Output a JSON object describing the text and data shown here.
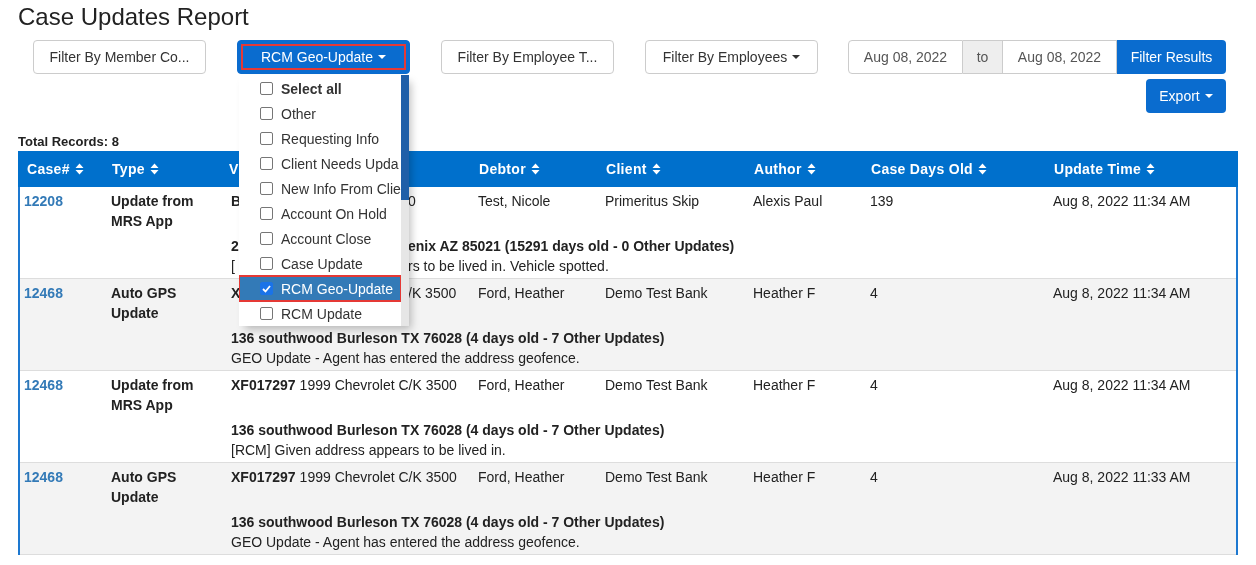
{
  "title": "Case Updates Report",
  "filters": [
    {
      "label": "Filter By Member Co...",
      "caret": false,
      "active": false,
      "annotated": false
    },
    {
      "label": "RCM Geo-Update",
      "caret": true,
      "active": true,
      "annotated": true
    },
    {
      "label": "Filter By Employee T...",
      "caret": false,
      "active": false,
      "annotated": false
    },
    {
      "label": "Filter By Employees",
      "caret": true,
      "active": false,
      "annotated": false
    }
  ],
  "dropdown": {
    "items": [
      {
        "label": "Select all",
        "kind": "all",
        "checked": false,
        "annotated": false
      },
      {
        "label": "Other",
        "kind": "option",
        "checked": false,
        "annotated": false
      },
      {
        "label": "Requesting Info",
        "kind": "option",
        "checked": false,
        "annotated": false
      },
      {
        "label": "Client Needs Upda",
        "kind": "option",
        "checked": false,
        "annotated": false
      },
      {
        "label": "New Info From Clie",
        "kind": "option",
        "checked": false,
        "annotated": false
      },
      {
        "label": "Account On Hold",
        "kind": "option",
        "checked": false,
        "annotated": false
      },
      {
        "label": "Account Close",
        "kind": "option",
        "checked": false,
        "annotated": false
      },
      {
        "label": "Case Update",
        "kind": "option",
        "checked": false,
        "annotated": false
      },
      {
        "label": "RCM Geo-Update",
        "kind": "option",
        "checked": true,
        "annotated": true
      },
      {
        "label": "RCM Update",
        "kind": "option",
        "checked": false,
        "annotated": false
      }
    ]
  },
  "date_range": {
    "from": "Aug 08, 2022",
    "separator": "to",
    "to": "Aug 08, 2022",
    "submit": "Filter Results"
  },
  "export": {
    "label": "Export"
  },
  "total_records": "Total Records: 8",
  "table": {
    "columns": [
      {
        "label": "Case#",
        "sortable": true
      },
      {
        "label": "Type",
        "sortable": true
      },
      {
        "label": "V",
        "sortable": false
      },
      {
        "label": "Debtor",
        "sortable": true
      },
      {
        "label": "Client",
        "sortable": true
      },
      {
        "label": "Author",
        "sortable": true
      },
      {
        "label": "Case Days Old",
        "sortable": true
      },
      {
        "label": "Update Time",
        "sortable": true
      }
    ],
    "rows": [
      {
        "case": "12208",
        "type": "Update from MRS App",
        "vehicle": [
          {
            "text": "B",
            "bold": true,
            "after_overlay": false
          },
          {
            "text": "0",
            "bold": false,
            "after_overlay": true
          }
        ],
        "debtor": "Test, Nicole",
        "client": "Primeritus Skip",
        "author": "Alexis Paul",
        "days": "139",
        "time": "Aug 8, 2022 11:34 AM",
        "address": [
          {
            "text": "2",
            "after_overlay": false
          },
          {
            "text": "enix AZ 85021 (15291 days old - 0 Other Updates)",
            "after_overlay": true
          }
        ],
        "note": [
          {
            "text": "[",
            "after_overlay": false
          },
          {
            "text": "rs to be lived in. Vehicle spotted.",
            "after_overlay": true
          }
        ]
      },
      {
        "case": "12468",
        "type": "Auto GPS Update",
        "vehicle": [
          {
            "text": "X",
            "bold": true,
            "after_overlay": false
          },
          {
            "text": "/K 3500",
            "bold": false,
            "after_overlay": true
          }
        ],
        "debtor": "Ford, Heather",
        "client": "Demo Test Bank",
        "author": "Heather F",
        "days": "4",
        "time": "Aug 8, 2022 11:34 AM",
        "address": [
          {
            "text": "136 southwood Burleson TX 76028 (4 days old - 7 Other Updates)"
          }
        ],
        "note": [
          {
            "text": "GEO Update - Agent has entered the address geofence."
          }
        ]
      },
      {
        "case": "12468",
        "type": "Update from MRS App",
        "vehicle": [
          {
            "text": "XF017297",
            "bold": true,
            "after_overlay": false
          },
          {
            "text": "1999 Chevrolet C/K 3500",
            "bold": false,
            "after_overlay": false
          }
        ],
        "debtor": "Ford, Heather",
        "client": "Demo Test Bank",
        "author": "Heather F",
        "days": "4",
        "time": "Aug 8, 2022 11:34 AM",
        "address": [
          {
            "text": "136 southwood Burleson TX 76028 (4 days old - 7 Other Updates)"
          }
        ],
        "note": [
          {
            "text": "[RCM] Given address appears to be lived in."
          }
        ]
      },
      {
        "case": "12468",
        "type": "Auto GPS Update",
        "vehicle": [
          {
            "text": "XF017297",
            "bold": true,
            "after_overlay": false
          },
          {
            "text": "1999 Chevrolet C/K 3500",
            "bold": false,
            "after_overlay": false
          }
        ],
        "debtor": "Ford, Heather",
        "client": "Demo Test Bank",
        "author": "Heather F",
        "days": "4",
        "time": "Aug 8, 2022 11:33 AM",
        "address": [
          {
            "text": "136 southwood Burleson TX 76028 (4 days old - 7 Other Updates)"
          }
        ],
        "note": [
          {
            "text": "GEO Update - Agent has entered the address geofence."
          }
        ]
      }
    ]
  }
}
